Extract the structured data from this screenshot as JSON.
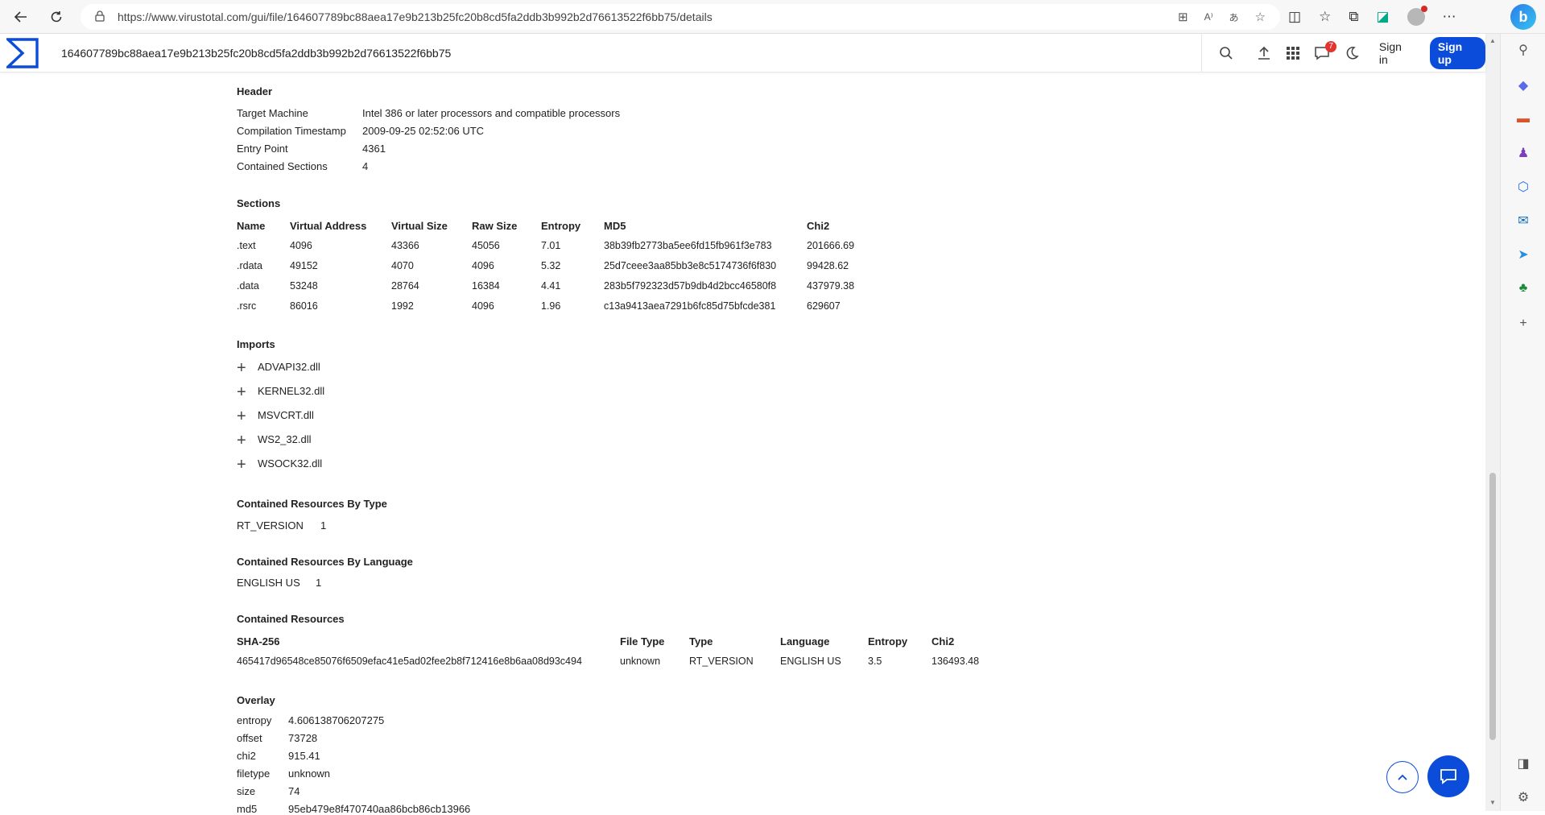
{
  "browser": {
    "url": "https://www.virustotal.com/gui/file/164607789bc88aea17e9b213b25fc20b8cd5fa2ddb3b992b2d76613522f6bb75/details"
  },
  "header": {
    "search_value": "164607789bc88aea17e9b213b25fc20b8cd5fa2ddb3b992b2d76613522f6bb75",
    "notifications_count": "7",
    "sign_in": "Sign in",
    "sign_up": "Sign up"
  },
  "pe_header": {
    "title": "Header",
    "rows": [
      {
        "k": "Target Machine",
        "v": "Intel 386 or later processors and compatible processors"
      },
      {
        "k": "Compilation Timestamp",
        "v": "2009-09-25 02:52:06 UTC"
      },
      {
        "k": "Entry Point",
        "v": "4361"
      },
      {
        "k": "Contained Sections",
        "v": "4"
      }
    ]
  },
  "sections": {
    "title": "Sections",
    "columns": [
      "Name",
      "Virtual Address",
      "Virtual Size",
      "Raw Size",
      "Entropy",
      "MD5",
      "Chi2"
    ],
    "rows": [
      [
        ".text",
        "4096",
        "43366",
        "45056",
        "7.01",
        "38b39fb2773ba5ee6fd15fb961f3e783",
        "201666.69"
      ],
      [
        ".rdata",
        "49152",
        "4070",
        "4096",
        "5.32",
        "25d7ceee3aa85bb3e8c5174736f6f830",
        "99428.62"
      ],
      [
        ".data",
        "53248",
        "28764",
        "16384",
        "4.41",
        "283b5f792323d57b9db4d2bcc46580f8",
        "437979.38"
      ],
      [
        ".rsrc",
        "86016",
        "1992",
        "4096",
        "1.96",
        "c13a9413aea7291b6fc85d75bfcde381",
        "629607"
      ]
    ]
  },
  "imports": {
    "title": "Imports",
    "items": [
      "ADVAPI32.dll",
      "KERNEL32.dll",
      "MSVCRT.dll",
      "WS2_32.dll",
      "WSOCK32.dll"
    ]
  },
  "resources_by_type": {
    "title": "Contained Resources By Type",
    "rows": [
      {
        "k": "RT_VERSION",
        "v": "1"
      }
    ]
  },
  "resources_by_language": {
    "title": "Contained Resources By Language",
    "rows": [
      {
        "k": "ENGLISH US",
        "v": "1"
      }
    ]
  },
  "contained_resources": {
    "title": "Contained Resources",
    "columns": [
      "SHA-256",
      "File Type",
      "Type",
      "Language",
      "Entropy",
      "Chi2"
    ],
    "rows": [
      [
        "465417d96548ce85076f6509efac41e5ad02fee2b8f712416e8b6aa08d93c494",
        "unknown",
        "RT_VERSION",
        "ENGLISH US",
        "3.5",
        "136493.48"
      ]
    ]
  },
  "overlay": {
    "title": "Overlay",
    "rows": [
      {
        "k": "entropy",
        "v": "4.606138706207275"
      },
      {
        "k": "offset",
        "v": "73728"
      },
      {
        "k": "chi2",
        "v": "915.41"
      },
      {
        "k": "filetype",
        "v": "unknown"
      },
      {
        "k": "size",
        "v": "74"
      },
      {
        "k": "md5",
        "v": "95eb479e8f470740aa86bcb86cb13966"
      }
    ]
  },
  "colors": {
    "accent": "#0b4dda",
    "badge": "#e3342f"
  },
  "icons": {
    "back": "back-arrow-icon",
    "refresh": "refresh-icon",
    "lock": "lock-icon",
    "search": "search-icon",
    "upload": "upload-icon",
    "apps": "grid-icon",
    "notifications": "chat-bubble-icon",
    "theme": "moon-icon"
  }
}
